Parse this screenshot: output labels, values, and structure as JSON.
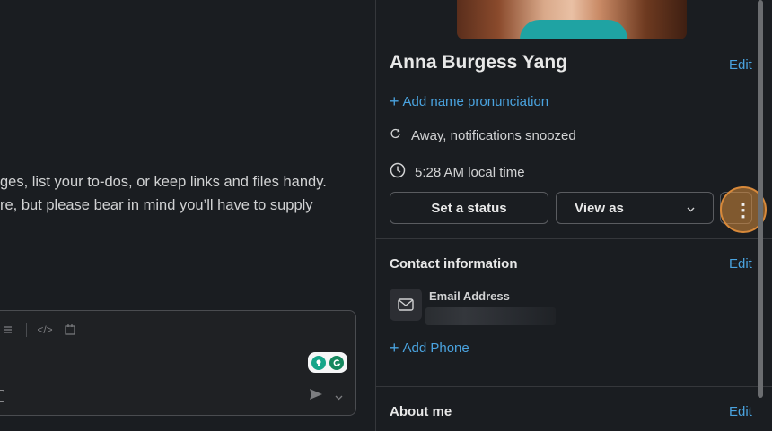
{
  "message": {
    "line1": "ges, list your to-dos, or keep links and files handy.",
    "line2": "re, but please bear in mind you’ll have to supply"
  },
  "composer": {
    "code_icon_glyph": "</>"
  },
  "profile": {
    "name": "Anna Burgess Yang",
    "edit_label": "Edit",
    "add_pronunciation": "Add name pronunciation",
    "status_text": "Away, notifications snoozed",
    "local_time": "5:28 AM local time",
    "set_status_label": "Set a status",
    "view_as_label": "View as",
    "more_glyph": "⋮"
  },
  "contact": {
    "title": "Contact information",
    "edit_label": "Edit",
    "email_label": "Email Address",
    "add_phone": "Add Phone"
  },
  "about": {
    "title": "About me",
    "edit_label": "Edit"
  },
  "colors": {
    "accent_link": "#4aa3df",
    "highlight": "#d8893a",
    "background": "#1a1d21"
  }
}
